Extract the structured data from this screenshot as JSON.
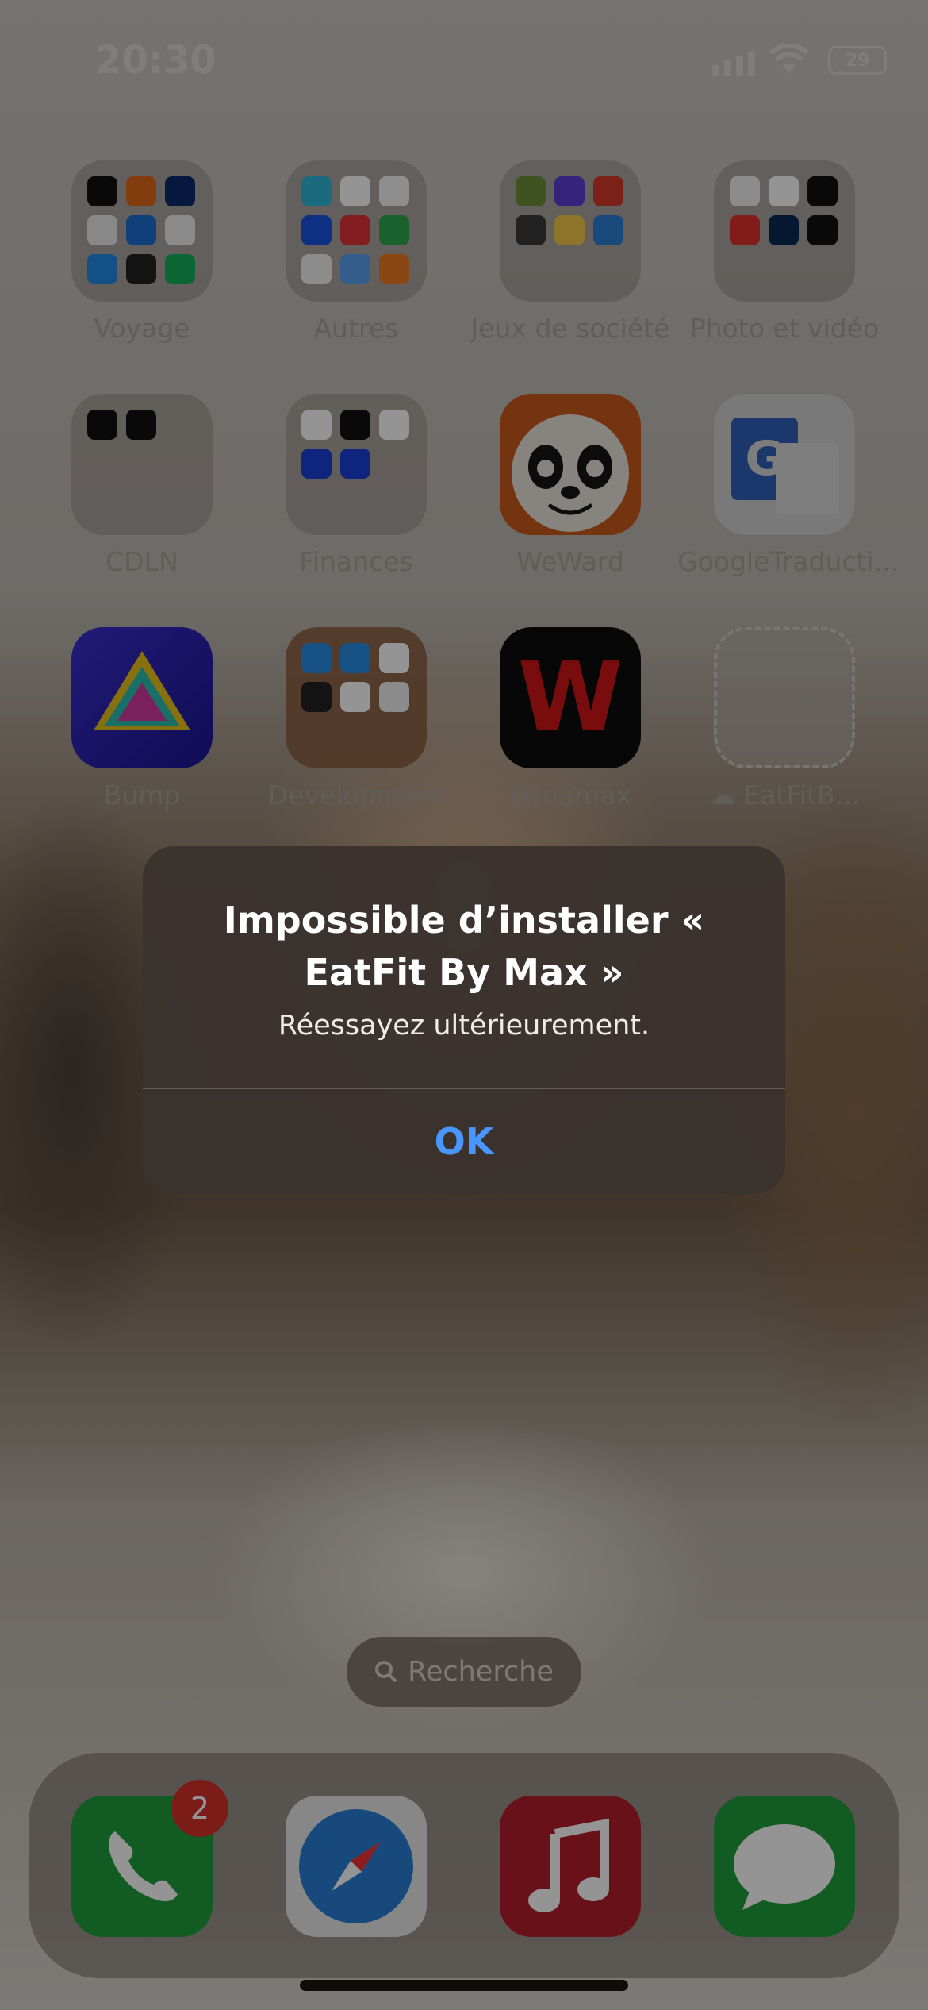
{
  "status_bar": {
    "time": "20:30",
    "battery": "29"
  },
  "apps": {
    "row1": [
      "Voyage",
      "Autres",
      "Jeux de société",
      "Photo et vidéo"
    ],
    "row2": [
      "CDLN",
      "Finances",
      "WeWard",
      "GoogleTraducti..."
    ],
    "row3": [
      "Bump",
      "Development",
      "Winamax",
      "EatFitB..."
    ]
  },
  "icon_glyphs": {
    "google_translate": "G",
    "winamax": "W",
    "cloud_download": "☁"
  },
  "alert": {
    "title": "Impossible d’installer « EatFit By Max »",
    "message": "Réessayez ultérieurement.",
    "ok_label": "OK"
  },
  "search": {
    "label": "Recherche"
  },
  "dock": {
    "phone_badge": "2"
  },
  "colors": {
    "accent_blue": "#4a96ff",
    "badge_red": "#d6312c"
  }
}
